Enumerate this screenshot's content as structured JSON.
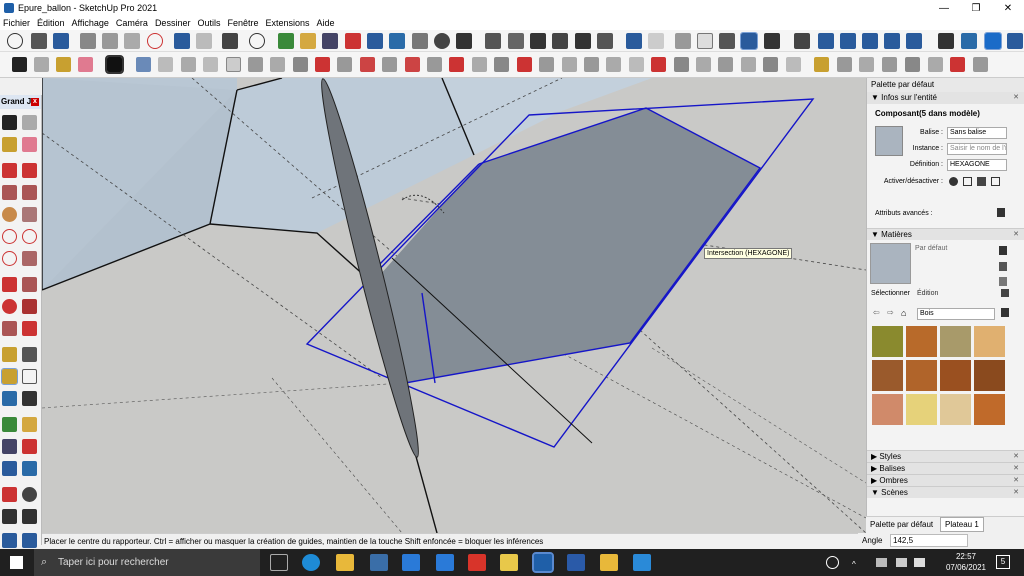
{
  "window": {
    "title": "Epure_ballon - SketchUp Pro 2021",
    "minimize": "—",
    "maximize": "❐",
    "close": "✕"
  },
  "menu": [
    "Fichier",
    "Édition",
    "Affichage",
    "Caméra",
    "Dessiner",
    "Outils",
    "Fenêtre",
    "Extensions",
    "Aide"
  ],
  "left_tray": {
    "title": "Grand J...",
    "close": "x"
  },
  "viewport": {
    "tooltip": "Intersection (HEXAGONE)",
    "colors": {
      "sky": "#b9c7d4",
      "ground": "#c9c9c7",
      "face": "#848d96",
      "selection": "#1515c8"
    }
  },
  "status": {
    "message": "Placer le centre du rapporteur. Ctrl = afficher ou masquer la création de guides, maintien de la touche Shift enfoncée = bloquer les inférences",
    "angle_label": "Angle",
    "angle_value": "142,5"
  },
  "right_panel": {
    "title": "Palette par défaut",
    "entity_info": {
      "header": "Infos sur l'entité",
      "type": "Composant(5 dans modèle)",
      "balise_label": "Balise :",
      "balise_value": "Sans balise",
      "instance_label": "Instance :",
      "instance_placeholder": "Saisir le nom de l'i",
      "definition_label": "Définition :",
      "definition_value": "HEXAGONE",
      "toggle_label": "Activer/désactiver :",
      "advanced_label": "Attributs avancés :"
    },
    "materials": {
      "header": "Matières",
      "current": "Par défaut",
      "tab_select": "Sélectionner",
      "tab_edit": "Édition",
      "library": "Bois",
      "swatches": [
        "#8a8a2e",
        "#b86a2a",
        "#a89a6a",
        "#e0b070",
        "#9a5a2c",
        "#b0642a",
        "#9a5020",
        "#8a4a1e",
        "#d08a6a",
        "#e6d27a",
        "#e0c898",
        "#c06a2a"
      ]
    },
    "collapsed_sections": [
      "Styles",
      "Balises",
      "Ombres",
      "Scènes"
    ],
    "bottom_tabs": [
      "Palette par défaut",
      "Plateau 1"
    ]
  },
  "taskbar": {
    "search_placeholder": "Taper ici pour rechercher",
    "time": "22:57",
    "date": "07/06/2021",
    "notification_count": "5"
  }
}
